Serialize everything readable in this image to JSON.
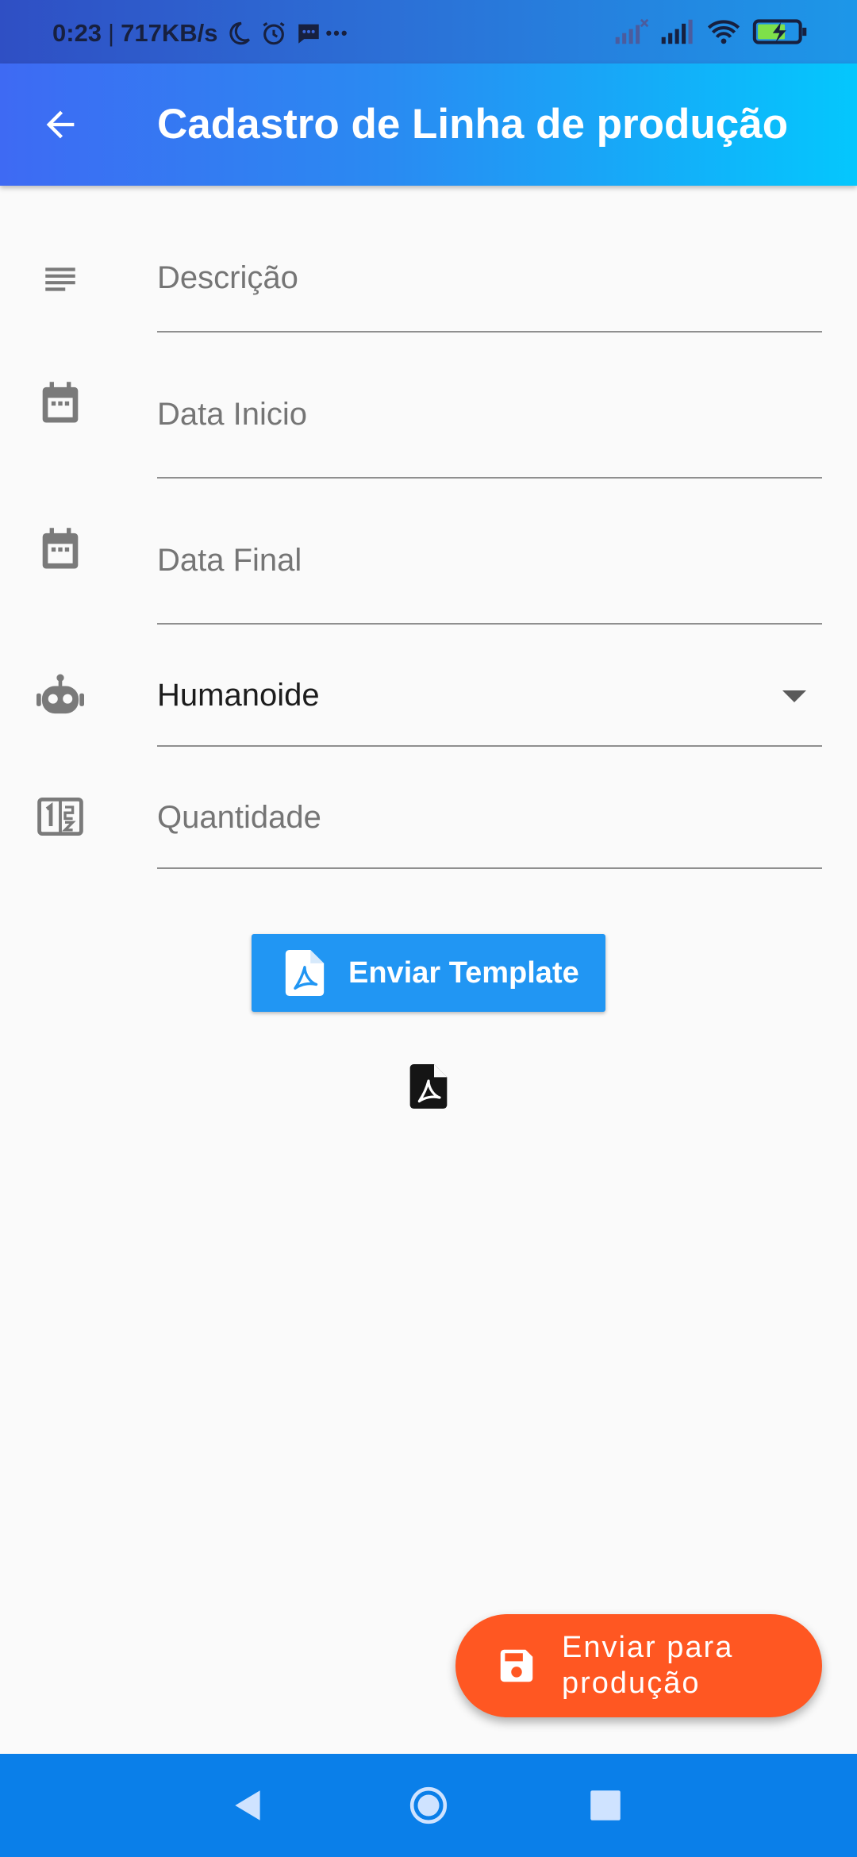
{
  "status_bar": {
    "time": "0:23",
    "separator": "|",
    "speed": "717KB/s",
    "more": "•••"
  },
  "app_bar": {
    "back_icon": "arrow-back-icon",
    "title": "Cadastro de Linha de produção"
  },
  "form": {
    "descricao": {
      "icon": "notes-icon",
      "placeholder": "Descrição"
    },
    "data_inicio": {
      "icon": "calendar-icon",
      "placeholder": "Data Inicio"
    },
    "data_final": {
      "icon": "calendar-icon",
      "placeholder": "Data Final"
    },
    "tipo": {
      "icon": "robot-icon",
      "value": "Humanoide"
    },
    "quantidade": {
      "icon": "numbers-icon",
      "placeholder": "Quantidade"
    }
  },
  "template_button": {
    "icon": "pdf-icon",
    "label": "Enviar Template"
  },
  "attachment": {
    "icon": "pdf-icon"
  },
  "fab": {
    "icon": "save-icon",
    "label_line1": "Enviar para",
    "label_line2": "produção"
  },
  "colors": {
    "app_bar_start": "#3e6af3",
    "app_bar_end": "#04c7fd",
    "button": "#2196f3",
    "fab": "#ff5722",
    "nav_bar": "#0a7fe9"
  }
}
